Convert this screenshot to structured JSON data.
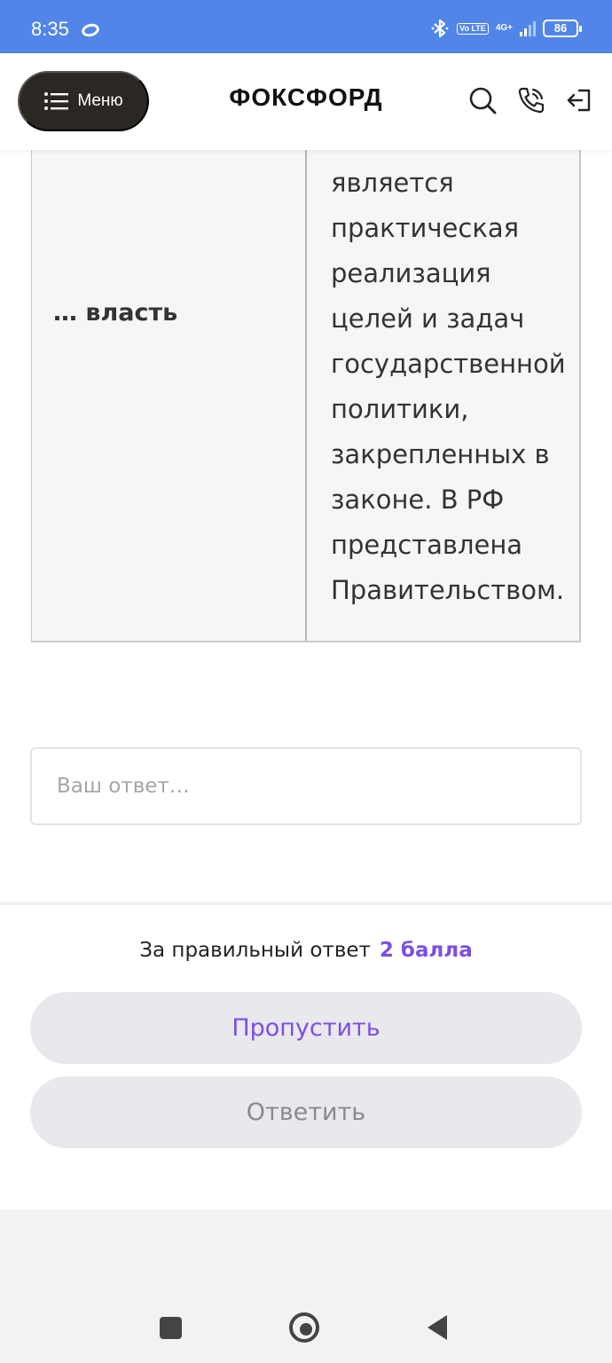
{
  "status_bar": {
    "time": "8:35",
    "volte_label": "Vo LTE",
    "network_label": "4G+",
    "battery_level": "86"
  },
  "header": {
    "menu_label": "Меню",
    "brand": "ФОКСФОРД"
  },
  "table": {
    "left_cell": "… власть",
    "right_cell": "является практическая реализация целей и задач государственной политики, закрепленных в законе. В РФ представлена Правительством."
  },
  "answer": {
    "placeholder": "Ваш ответ…",
    "value": ""
  },
  "points": {
    "label": "За правильный ответ",
    "value": "2 балла"
  },
  "buttons": {
    "skip_label": "Пропустить",
    "answer_label": "Ответить"
  },
  "colors": {
    "status_bar": "#5186e8",
    "accent": "#7d4fe0",
    "menu_button": "#2b2722",
    "button_bg": "#e8e8ed"
  },
  "icons": [
    "search-icon",
    "phone-icon",
    "login-icon",
    "menu-lines-icon",
    "bluetooth-icon"
  ]
}
